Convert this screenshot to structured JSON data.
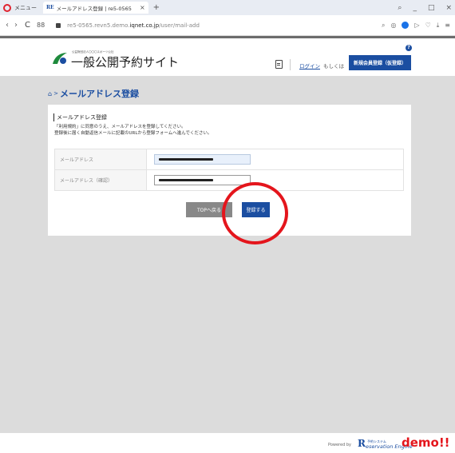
{
  "browser": {
    "menu_label": "メニュー",
    "tab_favicon": "RE",
    "tab_title": "メールアドレス登録 | re5-0565",
    "tab_close": "×",
    "new_tab": "+",
    "url_host": "re5-0565.revn5.demo.",
    "url_domain": "iqnet.co.jp",
    "url_path": "/user/mail-add",
    "nav_back": "‹",
    "nav_forward": "›",
    "reload": "C",
    "speeddial": "88",
    "win_min": "_",
    "win_max": "□",
    "win_close": "×",
    "search_icon": "⌕"
  },
  "header": {
    "logo_small": "公益財団法人〇〇〇スポーツ公社",
    "site_title": "一般公開予約サイト",
    "login_link": "ログイン",
    "or_text": "もしくは",
    "register_button": "新規会員登録（仮登録）",
    "help": "?"
  },
  "breadcrumb": {
    "separator": ">",
    "title": "メールアドレス登録"
  },
  "card": {
    "heading": "メールアドレス登録",
    "desc_line1": "「利用規約」に同意のうえ、メールアドレスを登録してください。",
    "desc_line2": "登録後に届く自動返信メールに記載のURLから登録フォームへ進んでください。",
    "fields": [
      {
        "label": "メールアドレス"
      },
      {
        "label": "メールアドレス（確認）"
      }
    ],
    "back_button": "TOPへ戻る",
    "submit_button": "登録する"
  },
  "footer": {
    "powered_by": "Powered by",
    "logo_mark": "R",
    "logo_sub": "予約システム",
    "logo_text": "eservation Engine",
    "demo_badge": "demo!!"
  },
  "colors": {
    "brand_blue": "#1b4ea1",
    "annotation_red": "#e4151c",
    "body_gray": "#dcdcdc"
  }
}
